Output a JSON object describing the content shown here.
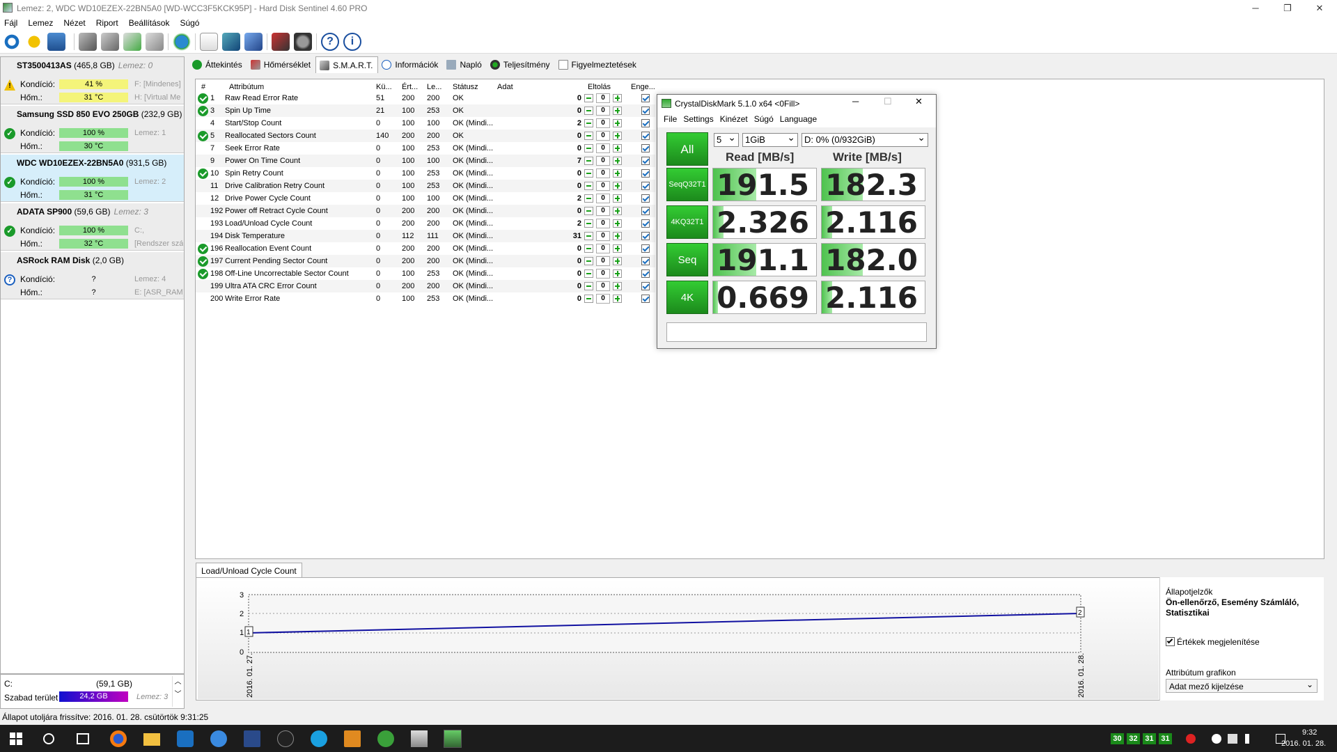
{
  "window": {
    "title": "Lemez: 2, WDC WD10EZEX-22BN5A0 [WD-WCC3F5KCK95P]  -  Hard Disk Sentinel 4.60 PRO",
    "min": "─",
    "max": "❐",
    "close": "✕"
  },
  "menu": [
    "Fájl",
    "Lemez",
    "Nézet",
    "Riport",
    "Beállítások",
    "Súgó"
  ],
  "disks": [
    {
      "name": "ST3500413AS",
      "cap": "(465,8 GB)",
      "lemez": "Lemez: 0",
      "status": "warn",
      "kond_label": "Kondíció:",
      "kond": "41 %",
      "kond_color": "y",
      "hom_label": "Hőm.:",
      "hom": "31 °C",
      "side1": "F: [Mindenes]",
      "side2": "H: [Virtual Me"
    },
    {
      "name": "Samsung SSD 850 EVO 250GB",
      "cap": "(232,9 GB)",
      "lemez": "",
      "status": "ok",
      "kond_label": "Kondíció:",
      "kond": "100 %",
      "kond_color": "g",
      "hom_label": "Hőm.:",
      "hom": "30 °C",
      "side1": "Lemez: 1",
      "side2": ""
    },
    {
      "name": "WDC WD10EZEX-22BN5A0",
      "cap": "(931,5 GB)",
      "lemez": "",
      "status": "ok",
      "kond_label": "Kondíció:",
      "kond": "100 %",
      "kond_color": "g",
      "hom_label": "Hőm.:",
      "hom": "31 °C",
      "side1": "Lemez: 2",
      "side2": ""
    },
    {
      "name": "ADATA SP900",
      "cap": "(59,6 GB)",
      "lemez": "Lemez: 3",
      "status": "ok",
      "kond_label": "Kondíció:",
      "kond": "100 %",
      "kond_color": "g",
      "hom_label": "Hőm.:",
      "hom": "32 °C",
      "side1": "C:,",
      "side2": "[Rendszer szá"
    },
    {
      "name": "ASRock  RAM Disk",
      "cap": "(2,0 GB)",
      "lemez": "",
      "status": "q",
      "kond_label": "Kondíció:",
      "kond": "?",
      "kond_color": "n",
      "hom_label": "Hőm.:",
      "hom": "?",
      "side1": "Lemez: 4",
      "side2": "E: [ASR_RAM]"
    }
  ],
  "tabs": [
    "Áttekintés",
    "Hőmérséklet",
    "S.M.A.R.T.",
    "Információk",
    "Napló",
    "Teljesítmény",
    "Figyelmeztetések"
  ],
  "smart": {
    "headers": {
      "num": "#",
      "attr": "Attribútum",
      "ku": "Kü...",
      "ert": "Ért...",
      "le": "Le...",
      "status": "Státusz",
      "adat": "Adat",
      "eltolas": "Eltolás",
      "enge": "Enge..."
    },
    "rows": [
      {
        "ok": true,
        "num": "1",
        "attr": "Raw Read Error Rate",
        "ku": "51",
        "ert": "200",
        "le": "200",
        "status": "OK",
        "adat": "0",
        "off": "0"
      },
      {
        "ok": true,
        "num": "3",
        "attr": "Spin Up Time",
        "ku": "21",
        "ert": "100",
        "le": "253",
        "status": "OK",
        "adat": "0",
        "off": "0"
      },
      {
        "ok": false,
        "num": "4",
        "attr": "Start/Stop Count",
        "ku": "0",
        "ert": "100",
        "le": "100",
        "status": "OK (Mindi...",
        "adat": "2",
        "off": "0"
      },
      {
        "ok": true,
        "num": "5",
        "attr": "Reallocated Sectors Count",
        "ku": "140",
        "ert": "200",
        "le": "200",
        "status": "OK",
        "adat": "0",
        "off": "0"
      },
      {
        "ok": false,
        "num": "7",
        "attr": "Seek Error Rate",
        "ku": "0",
        "ert": "100",
        "le": "253",
        "status": "OK (Mindi...",
        "adat": "0",
        "off": "0"
      },
      {
        "ok": false,
        "num": "9",
        "attr": "Power On Time Count",
        "ku": "0",
        "ert": "100",
        "le": "100",
        "status": "OK (Mindi...",
        "adat": "7",
        "off": "0"
      },
      {
        "ok": true,
        "num": "10",
        "attr": "Spin Retry Count",
        "ku": "0",
        "ert": "100",
        "le": "253",
        "status": "OK (Mindi...",
        "adat": "0",
        "off": "0"
      },
      {
        "ok": false,
        "num": "11",
        "attr": "Drive Calibration Retry Count",
        "ku": "0",
        "ert": "100",
        "le": "253",
        "status": "OK (Mindi...",
        "adat": "0",
        "off": "0"
      },
      {
        "ok": false,
        "num": "12",
        "attr": "Drive Power Cycle Count",
        "ku": "0",
        "ert": "100",
        "le": "100",
        "status": "OK (Mindi...",
        "adat": "2",
        "off": "0"
      },
      {
        "ok": false,
        "num": "192",
        "attr": "Power off Retract Cycle Count",
        "ku": "0",
        "ert": "200",
        "le": "200",
        "status": "OK (Mindi...",
        "adat": "0",
        "off": "0"
      },
      {
        "ok": false,
        "num": "193",
        "attr": "Load/Unload Cycle Count",
        "ku": "0",
        "ert": "200",
        "le": "200",
        "status": "OK (Mindi...",
        "adat": "2",
        "off": "0"
      },
      {
        "ok": false,
        "num": "194",
        "attr": "Disk Temperature",
        "ku": "0",
        "ert": "112",
        "le": "111",
        "status": "OK (Mindi...",
        "adat": "31",
        "off": "0"
      },
      {
        "ok": true,
        "num": "196",
        "attr": "Reallocation Event Count",
        "ku": "0",
        "ert": "200",
        "le": "200",
        "status": "OK (Mindi...",
        "adat": "0",
        "off": "0"
      },
      {
        "ok": true,
        "num": "197",
        "attr": "Current Pending Sector Count",
        "ku": "0",
        "ert": "200",
        "le": "200",
        "status": "OK (Mindi...",
        "adat": "0",
        "off": "0"
      },
      {
        "ok": true,
        "num": "198",
        "attr": "Off-Line Uncorrectable Sector Count",
        "ku": "0",
        "ert": "100",
        "le": "253",
        "status": "OK (Mindi...",
        "adat": "0",
        "off": "0"
      },
      {
        "ok": false,
        "num": "199",
        "attr": "Ultra ATA CRC Error Count",
        "ku": "0",
        "ert": "200",
        "le": "200",
        "status": "OK (Mindi...",
        "adat": "0",
        "off": "0"
      },
      {
        "ok": false,
        "num": "200",
        "attr": "Write Error Rate",
        "ku": "0",
        "ert": "100",
        "le": "253",
        "status": "OK (Mindi...",
        "adat": "0",
        "off": "0"
      }
    ]
  },
  "cdm": {
    "title": "CrystalDiskMark 5.1.0 x64 <0Fill>",
    "menu": [
      "File",
      "Settings",
      "Kinézet",
      "Súgó",
      "Language"
    ],
    "all": "All",
    "count": "5",
    "size": "1GiB",
    "drive": "D: 0% (0/932GiB)",
    "read_h": "Read [MB/s]",
    "write_h": "Write [MB/s]",
    "tests": [
      {
        "label1": "Seq",
        "label2": "Q32T1",
        "read": "191.5",
        "write": "182.3",
        "read_fill": 0.42,
        "write_fill": 0.4
      },
      {
        "label1": "4K",
        "label2": "Q32T1",
        "read": "2.326",
        "write": "2.116",
        "read_fill": 0.1,
        "write_fill": 0.1
      },
      {
        "label1": "Seq",
        "label2": "",
        "read": "191.1",
        "write": "182.0",
        "read_fill": 0.42,
        "write_fill": 0.4
      },
      {
        "label1": "4K",
        "label2": "",
        "read": "0.669",
        "write": "2.116",
        "read_fill": 0.05,
        "write_fill": 0.1
      }
    ]
  },
  "graph": {
    "tab": "Load/Unload Cycle Count",
    "y_ticks": [
      "3",
      "2",
      "1",
      "0"
    ],
    "start_label": "1",
    "end_label": "2",
    "x_start": "2016. 01. 27.",
    "x_end": "2016. 01. 28.",
    "side_title": "Állapotjelzők",
    "side_sub": "Ön-ellenőrző, Esemény Számláló, Statisztikai",
    "show_values": "Értékek megjelenítése",
    "attr_graph": "Attribútum grafikon",
    "attr_select": "Adat mező kijelzése"
  },
  "free": {
    "drive": "C:",
    "size": "(59,1 GB)",
    "label": "Szabad terület",
    "value": "24,2 GB",
    "lemez": "Lemez: 3"
  },
  "status_text": "Állapot utoljára frissítve: 2016. 01. 28. csütörtök 9:31:25",
  "taskbar": {
    "time": "9:32",
    "date": "2016. 01. 28.",
    "tray_nums": [
      "30",
      "32",
      "31",
      "31"
    ]
  }
}
